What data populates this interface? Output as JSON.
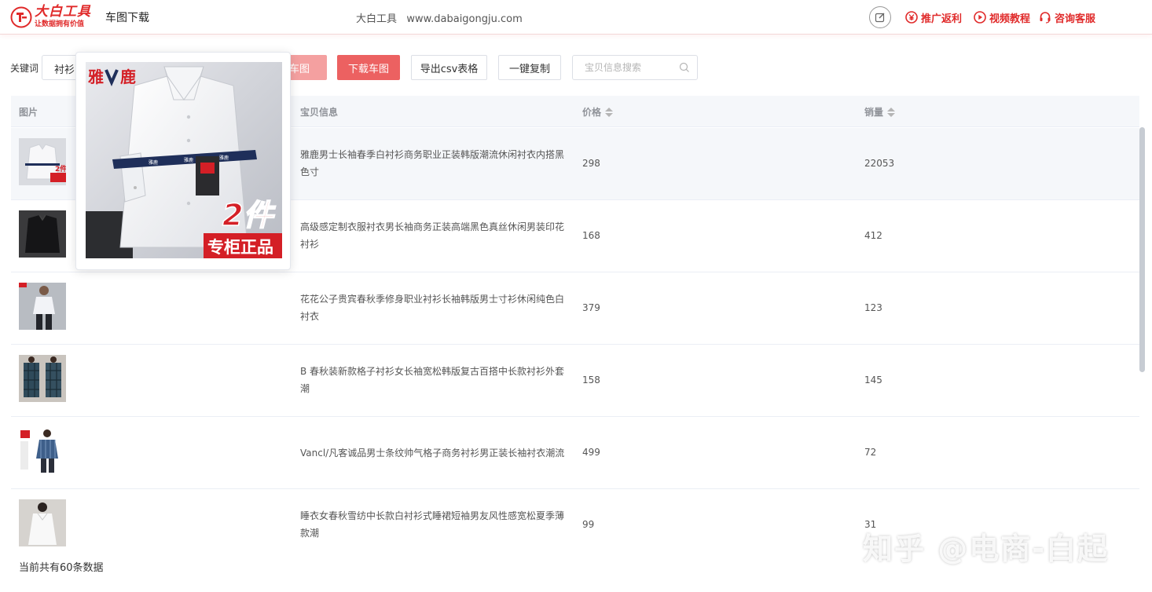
{
  "header": {
    "logo_title": "大白工具",
    "logo_slogan": "让数据拥有价值",
    "page_title": "车图下载",
    "site_name": "大白工具",
    "site_url": "www.dabaigongju.com",
    "links": [
      {
        "label": "推广返利",
        "icon": "yen-circle-icon"
      },
      {
        "label": "视频教程",
        "icon": "play-circle-icon"
      },
      {
        "label": "咨询客服",
        "icon": "headset-icon"
      }
    ],
    "accent_color": "#e02a2a"
  },
  "toolbar": {
    "keyword_label": "关键词",
    "keyword_value": "衬衫",
    "btn_view": "查看车图",
    "btn_download": "下载车图",
    "btn_export": "导出csv表格",
    "btn_copy": "一键复制",
    "search_placeholder": "宝贝信息搜索"
  },
  "table": {
    "columns": [
      "图片",
      "宝贝信息",
      "价格",
      "销量"
    ],
    "rows": [
      {
        "title": "雅鹿男士长袖春季白衬衫商务职业正装韩版潮流休闲衬衣内搭黑色寸",
        "price": "298",
        "sales": "22053"
      },
      {
        "title": "高级感定制衣服衬衣男长袖商务正装高端黑色真丝休闲男装印花衬衫",
        "price": "168",
        "sales": "412"
      },
      {
        "title": "花花公子贵宾春秋季修身职业衬衫长袖韩版男士寸衫休闲纯色白衬衣",
        "price": "379",
        "sales": "123"
      },
      {
        "title": "B 春秋装新款格子衬衫女长袖宽松韩版复古百搭中长款衬衫外套潮",
        "price": "158",
        "sales": "145"
      },
      {
        "title": "Vancl/凡客诚品男士条纹帅气格子商务衬衫男正装长袖衬衣潮流",
        "price": "499",
        "sales": "72"
      },
      {
        "title": "睡衣女春秋雪纺中长款白衬衫式睡裙短袖男友风性感宽松夏季薄款潮",
        "price": "99",
        "sales": "31"
      }
    ]
  },
  "popover": {
    "brand": "雅鹿",
    "badge_count": "2件",
    "badge_text": "专柜正品"
  },
  "footer": {
    "total_text": "当前共有60条数据",
    "watermark": "知乎 @电商-白起"
  }
}
